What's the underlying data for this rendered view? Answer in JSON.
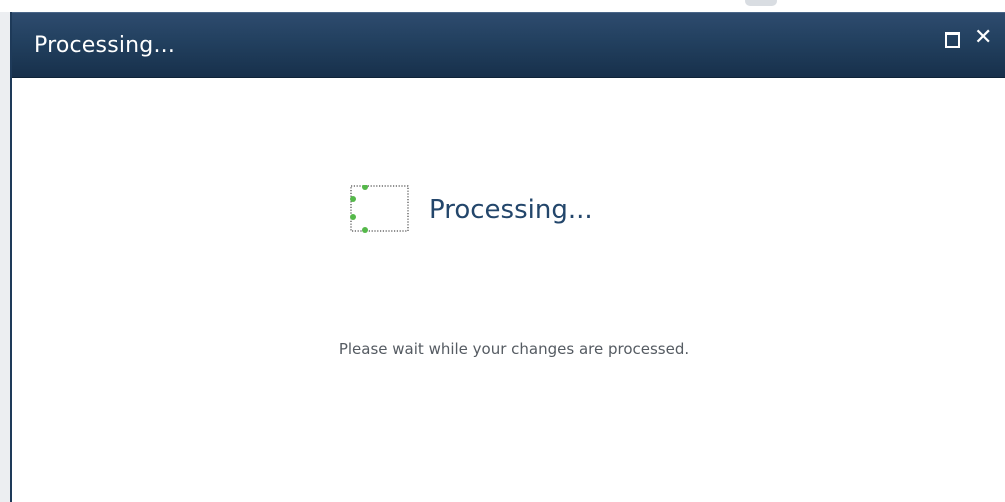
{
  "dialog": {
    "title": "Processing...",
    "buttons": {
      "maximize_icon": "maximize-icon",
      "close_icon": "close-icon",
      "close_glyph": "✕"
    },
    "body": {
      "heading": "Processing...",
      "message": "Please wait while your changes are processed.",
      "spinner_icon": "loading-spinner-icon"
    }
  },
  "colors": {
    "titlebar": "#22405f",
    "heading_text": "#23466b",
    "message_text": "#555b62",
    "spinner_dots": "#55b84a"
  }
}
